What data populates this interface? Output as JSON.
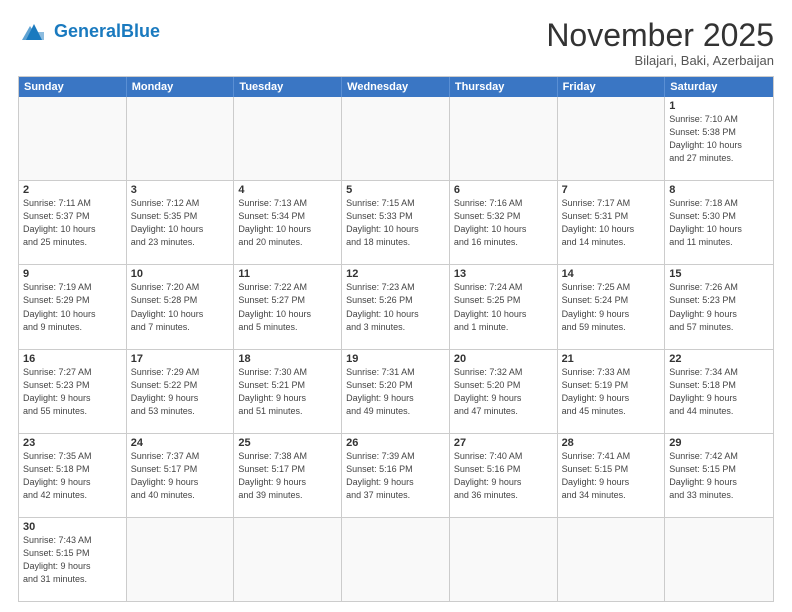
{
  "logo": {
    "general": "General",
    "blue": "Blue"
  },
  "header": {
    "month": "November 2025",
    "location": "Bilajari, Baki, Azerbaijan"
  },
  "weekdays": [
    "Sunday",
    "Monday",
    "Tuesday",
    "Wednesday",
    "Thursday",
    "Friday",
    "Saturday"
  ],
  "cells": [
    {
      "day": "",
      "empty": true,
      "info": ""
    },
    {
      "day": "",
      "empty": true,
      "info": ""
    },
    {
      "day": "",
      "empty": true,
      "info": ""
    },
    {
      "day": "",
      "empty": true,
      "info": ""
    },
    {
      "day": "",
      "empty": true,
      "info": ""
    },
    {
      "day": "",
      "empty": true,
      "info": ""
    },
    {
      "day": "1",
      "empty": false,
      "info": "Sunrise: 7:10 AM\nSunset: 5:38 PM\nDaylight: 10 hours\nand 27 minutes."
    },
    {
      "day": "2",
      "empty": false,
      "info": "Sunrise: 7:11 AM\nSunset: 5:37 PM\nDaylight: 10 hours\nand 25 minutes."
    },
    {
      "day": "3",
      "empty": false,
      "info": "Sunrise: 7:12 AM\nSunset: 5:35 PM\nDaylight: 10 hours\nand 23 minutes."
    },
    {
      "day": "4",
      "empty": false,
      "info": "Sunrise: 7:13 AM\nSunset: 5:34 PM\nDaylight: 10 hours\nand 20 minutes."
    },
    {
      "day": "5",
      "empty": false,
      "info": "Sunrise: 7:15 AM\nSunset: 5:33 PM\nDaylight: 10 hours\nand 18 minutes."
    },
    {
      "day": "6",
      "empty": false,
      "info": "Sunrise: 7:16 AM\nSunset: 5:32 PM\nDaylight: 10 hours\nand 16 minutes."
    },
    {
      "day": "7",
      "empty": false,
      "info": "Sunrise: 7:17 AM\nSunset: 5:31 PM\nDaylight: 10 hours\nand 14 minutes."
    },
    {
      "day": "8",
      "empty": false,
      "info": "Sunrise: 7:18 AM\nSunset: 5:30 PM\nDaylight: 10 hours\nand 11 minutes."
    },
    {
      "day": "9",
      "empty": false,
      "info": "Sunrise: 7:19 AM\nSunset: 5:29 PM\nDaylight: 10 hours\nand 9 minutes."
    },
    {
      "day": "10",
      "empty": false,
      "info": "Sunrise: 7:20 AM\nSunset: 5:28 PM\nDaylight: 10 hours\nand 7 minutes."
    },
    {
      "day": "11",
      "empty": false,
      "info": "Sunrise: 7:22 AM\nSunset: 5:27 PM\nDaylight: 10 hours\nand 5 minutes."
    },
    {
      "day": "12",
      "empty": false,
      "info": "Sunrise: 7:23 AM\nSunset: 5:26 PM\nDaylight: 10 hours\nand 3 minutes."
    },
    {
      "day": "13",
      "empty": false,
      "info": "Sunrise: 7:24 AM\nSunset: 5:25 PM\nDaylight: 10 hours\nand 1 minute."
    },
    {
      "day": "14",
      "empty": false,
      "info": "Sunrise: 7:25 AM\nSunset: 5:24 PM\nDaylight: 9 hours\nand 59 minutes."
    },
    {
      "day": "15",
      "empty": false,
      "info": "Sunrise: 7:26 AM\nSunset: 5:23 PM\nDaylight: 9 hours\nand 57 minutes."
    },
    {
      "day": "16",
      "empty": false,
      "info": "Sunrise: 7:27 AM\nSunset: 5:23 PM\nDaylight: 9 hours\nand 55 minutes."
    },
    {
      "day": "17",
      "empty": false,
      "info": "Sunrise: 7:29 AM\nSunset: 5:22 PM\nDaylight: 9 hours\nand 53 minutes."
    },
    {
      "day": "18",
      "empty": false,
      "info": "Sunrise: 7:30 AM\nSunset: 5:21 PM\nDaylight: 9 hours\nand 51 minutes."
    },
    {
      "day": "19",
      "empty": false,
      "info": "Sunrise: 7:31 AM\nSunset: 5:20 PM\nDaylight: 9 hours\nand 49 minutes."
    },
    {
      "day": "20",
      "empty": false,
      "info": "Sunrise: 7:32 AM\nSunset: 5:20 PM\nDaylight: 9 hours\nand 47 minutes."
    },
    {
      "day": "21",
      "empty": false,
      "info": "Sunrise: 7:33 AM\nSunset: 5:19 PM\nDaylight: 9 hours\nand 45 minutes."
    },
    {
      "day": "22",
      "empty": false,
      "info": "Sunrise: 7:34 AM\nSunset: 5:18 PM\nDaylight: 9 hours\nand 44 minutes."
    },
    {
      "day": "23",
      "empty": false,
      "info": "Sunrise: 7:35 AM\nSunset: 5:18 PM\nDaylight: 9 hours\nand 42 minutes."
    },
    {
      "day": "24",
      "empty": false,
      "info": "Sunrise: 7:37 AM\nSunset: 5:17 PM\nDaylight: 9 hours\nand 40 minutes."
    },
    {
      "day": "25",
      "empty": false,
      "info": "Sunrise: 7:38 AM\nSunset: 5:17 PM\nDaylight: 9 hours\nand 39 minutes."
    },
    {
      "day": "26",
      "empty": false,
      "info": "Sunrise: 7:39 AM\nSunset: 5:16 PM\nDaylight: 9 hours\nand 37 minutes."
    },
    {
      "day": "27",
      "empty": false,
      "info": "Sunrise: 7:40 AM\nSunset: 5:16 PM\nDaylight: 9 hours\nand 36 minutes."
    },
    {
      "day": "28",
      "empty": false,
      "info": "Sunrise: 7:41 AM\nSunset: 5:15 PM\nDaylight: 9 hours\nand 34 minutes."
    },
    {
      "day": "29",
      "empty": false,
      "info": "Sunrise: 7:42 AM\nSunset: 5:15 PM\nDaylight: 9 hours\nand 33 minutes."
    },
    {
      "day": "30",
      "empty": false,
      "info": "Sunrise: 7:43 AM\nSunset: 5:15 PM\nDaylight: 9 hours\nand 31 minutes."
    },
    {
      "day": "",
      "empty": true,
      "info": ""
    },
    {
      "day": "",
      "empty": true,
      "info": ""
    },
    {
      "day": "",
      "empty": true,
      "info": ""
    },
    {
      "day": "",
      "empty": true,
      "info": ""
    },
    {
      "day": "",
      "empty": true,
      "info": ""
    },
    {
      "day": "",
      "empty": true,
      "info": ""
    }
  ]
}
